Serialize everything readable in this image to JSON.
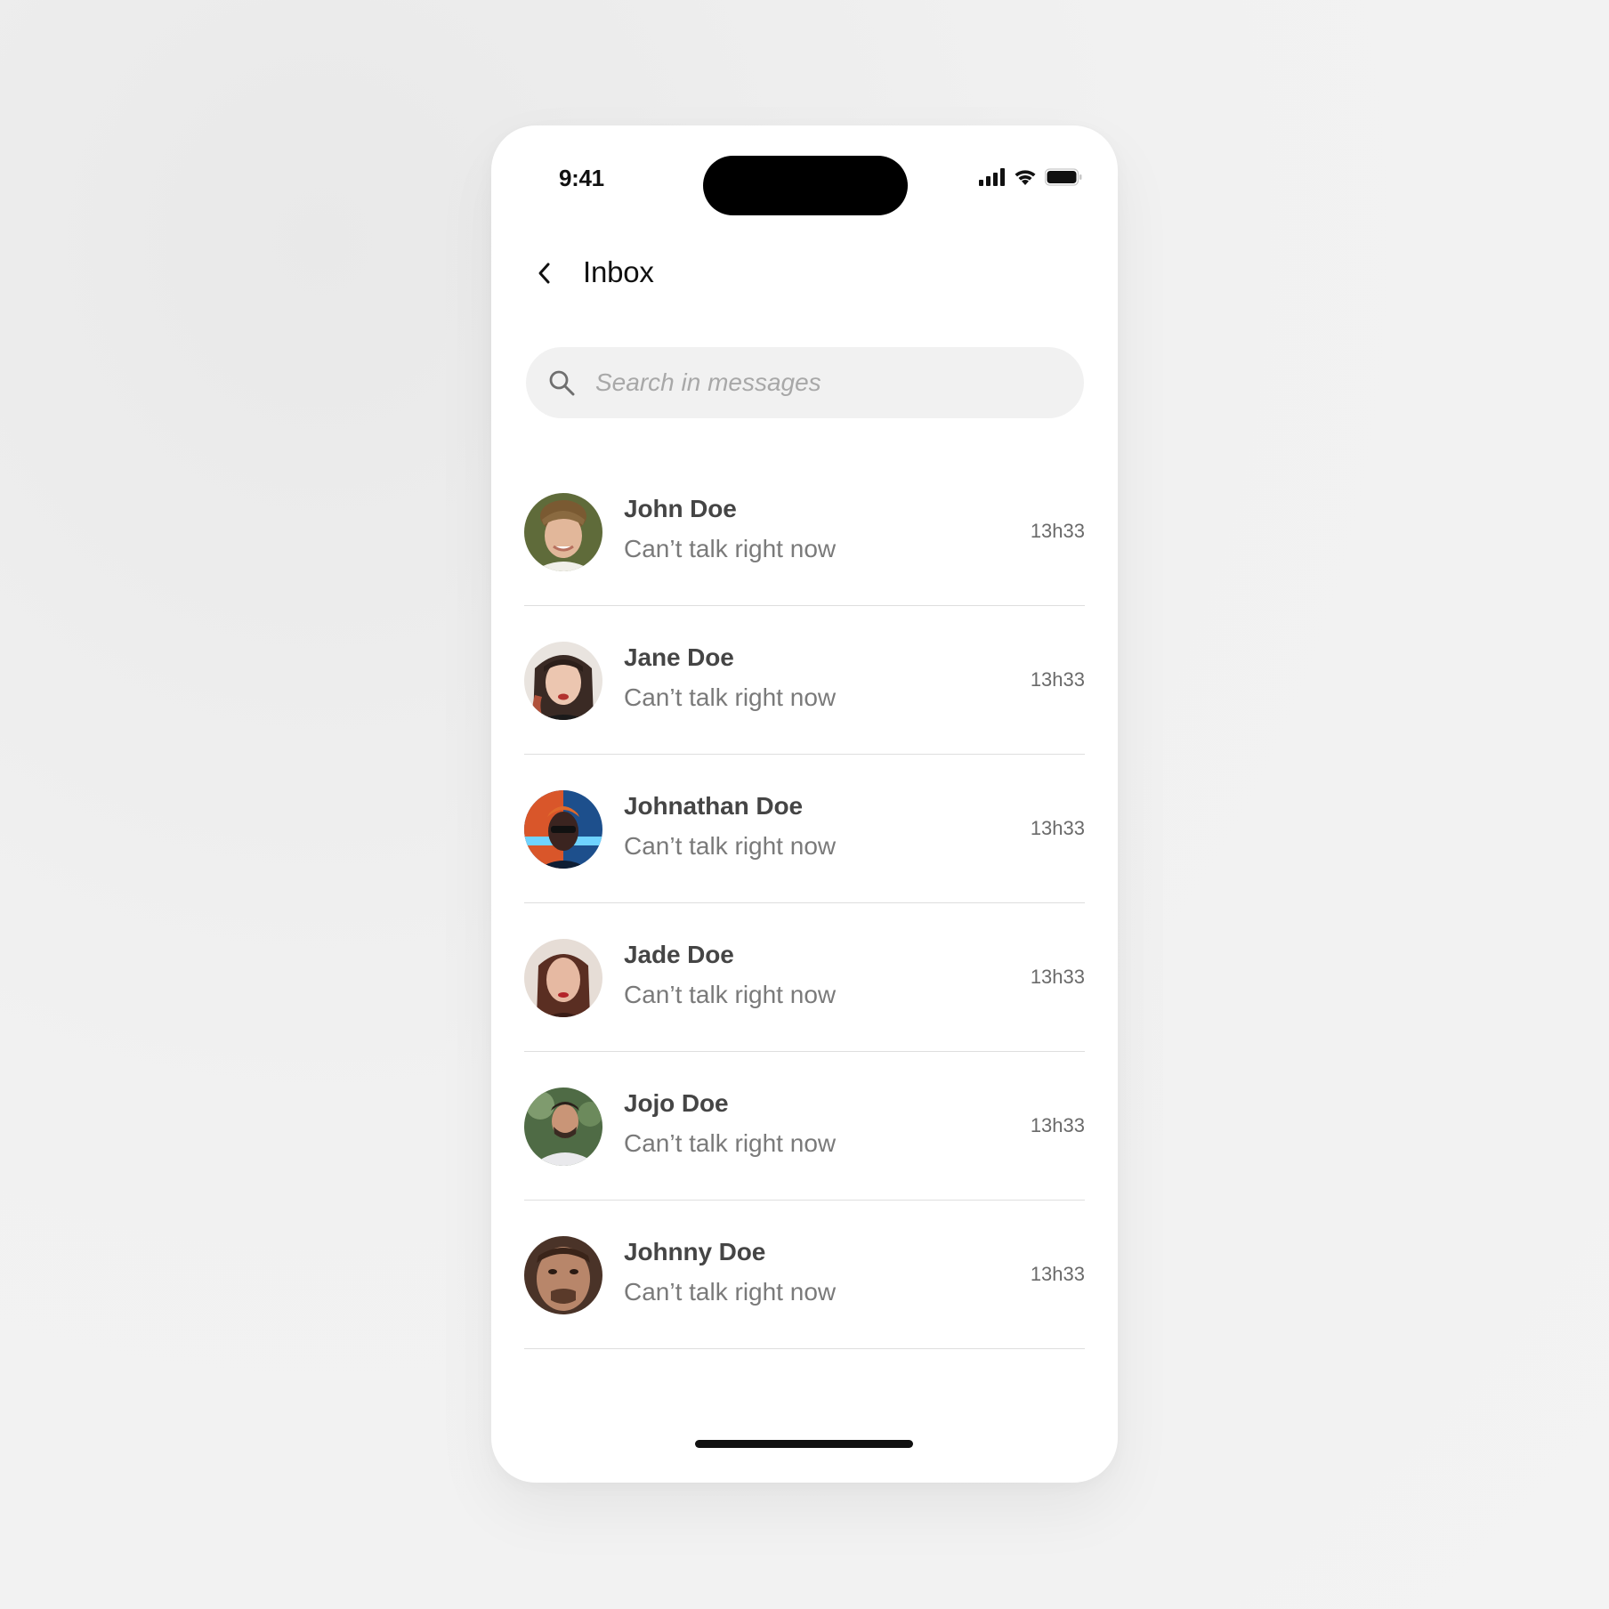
{
  "status_bar": {
    "time": "9:41",
    "icons": [
      "cellular-signal-icon",
      "wifi-icon",
      "battery-icon"
    ]
  },
  "header": {
    "title": "Inbox",
    "back_icon": "chevron-left-icon"
  },
  "search": {
    "placeholder": "Search in messages",
    "value": "",
    "icon": "search-icon"
  },
  "conversations": [
    {
      "name": "John Doe",
      "preview": "Can’t talk right now",
      "time": "13h33"
    },
    {
      "name": "Jane Doe",
      "preview": "Can’t talk right now",
      "time": "13h33"
    },
    {
      "name": "Johnathan Doe",
      "preview": "Can’t talk right now",
      "time": "13h33"
    },
    {
      "name": "Jade Doe",
      "preview": "Can’t talk right now",
      "time": "13h33"
    },
    {
      "name": "Jojo Doe",
      "preview": "Can’t talk right now",
      "time": "13h33"
    },
    {
      "name": "Johnny Doe",
      "preview": "Can’t talk right now",
      "time": "13h33"
    }
  ],
  "colors": {
    "background": "#f2f2f2",
    "surface": "#ffffff",
    "search_fill": "#f1f1f1",
    "name_text": "#454545",
    "preview_text": "#7a7a7a",
    "divider": "#dedede"
  }
}
